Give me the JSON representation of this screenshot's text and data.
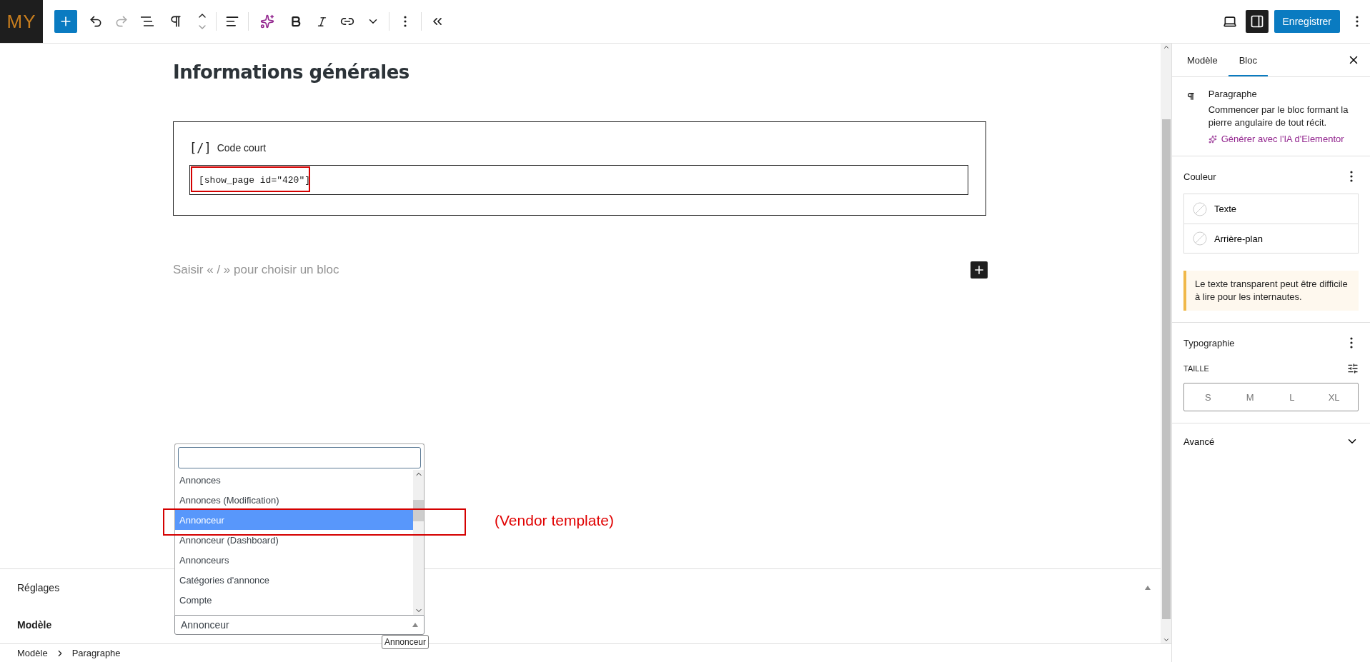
{
  "logo": "MY",
  "toolbar": {
    "redo_disabled": true,
    "settings_pressed": true,
    "save": "Enregistrer"
  },
  "editor": {
    "heading": "Informations générales",
    "shortcode_block": {
      "icon_text": "[/]",
      "label": "Code court",
      "value": "[show_page id=\"420\"]",
      "annotated": true
    },
    "placeholder": "Saisir « / » pour choisir un bloc"
  },
  "meta_panel": {
    "title": "Réglages",
    "expanded": true,
    "field_label": "Modèle",
    "select": {
      "value": "Annonceur",
      "open": true,
      "tooltip": "Annonceur",
      "annotation_note": "(Vendor template)",
      "options": [
        {
          "label": "Annonces",
          "selected": false,
          "annotated": false
        },
        {
          "label": "Annonces (Modification)",
          "selected": false,
          "annotated": false
        },
        {
          "label": "Annonceur",
          "selected": true,
          "annotated": true
        },
        {
          "label": "Annonceur (Dashboard)",
          "selected": false,
          "annotated": false
        },
        {
          "label": "Annonceurs",
          "selected": false,
          "annotated": false
        },
        {
          "label": "Catégories d'annonce",
          "selected": false,
          "annotated": false
        },
        {
          "label": "Compte",
          "selected": false,
          "annotated": false
        }
      ]
    }
  },
  "breadcrumb": [
    "Modèle",
    "Paragraphe"
  ],
  "sidebar": {
    "tabs": [
      {
        "label": "Modèle",
        "selected": false
      },
      {
        "label": "Bloc",
        "selected": true
      }
    ],
    "block": {
      "title": "Paragraphe",
      "description": "Commencer par le bloc formant la pierre angulaire de tout récit.",
      "ai_link": "Générer avec l'IA d'Elementor"
    },
    "color": {
      "title": "Couleur",
      "items": [
        {
          "label": "Texte"
        },
        {
          "label": "Arrière-plan"
        }
      ],
      "notice": "Le texte transparent peut être difficile à lire pour les internautes."
    },
    "typography": {
      "title": "Typographie",
      "size_label": "TAILLE",
      "sizes": [
        {
          "label": "S",
          "selected": false
        },
        {
          "label": "M",
          "selected": false
        },
        {
          "label": "L",
          "selected": false
        },
        {
          "label": "XL",
          "selected": false
        }
      ]
    },
    "advanced": {
      "title": "Avancé",
      "expanded": false
    }
  }
}
